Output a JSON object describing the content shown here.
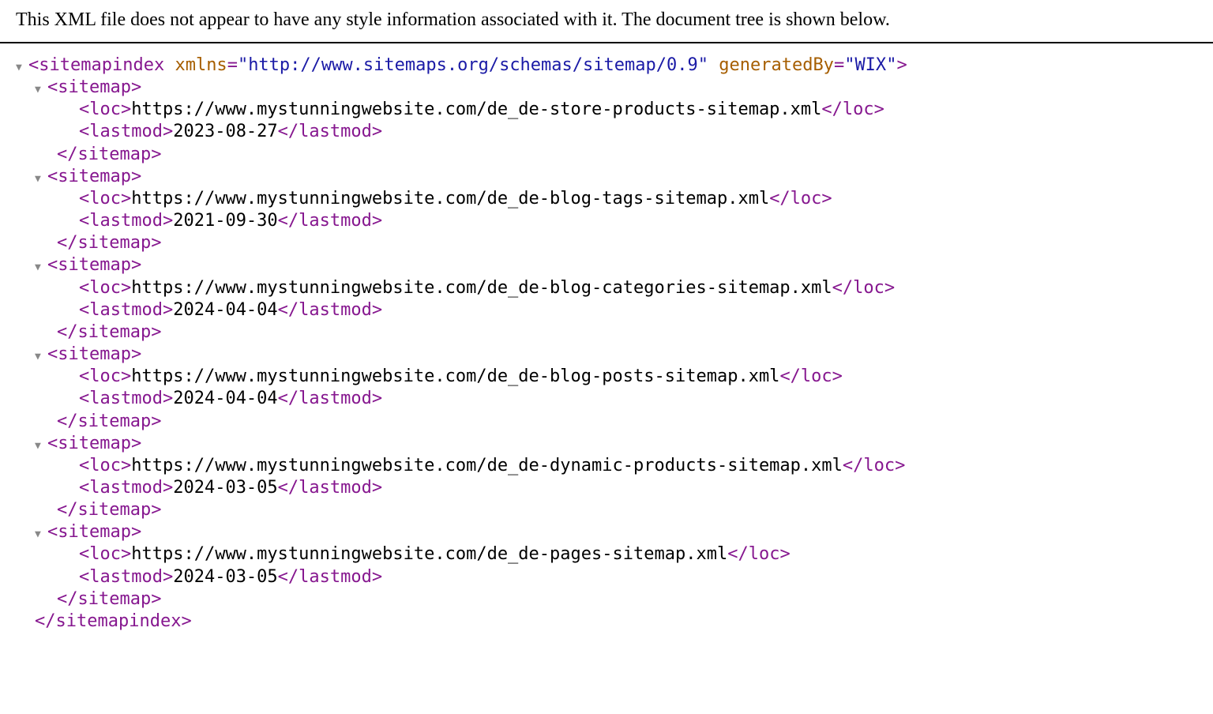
{
  "notice": "This XML file does not appear to have any style information associated with it. The document tree is shown below.",
  "root": {
    "name": "sitemapindex",
    "attrs": [
      {
        "k": "xmlns",
        "v": "http://www.sitemaps.org/schemas/sitemap/0.9"
      },
      {
        "k": "generatedBy",
        "v": "WIX"
      }
    ]
  },
  "sitemap_tag": "sitemap",
  "loc_tag": "loc",
  "lastmod_tag": "lastmod",
  "sitemaps": [
    {
      "loc": "https://www.mystunningwebsite.com/de_de-store-products-sitemap.xml",
      "lastmod": "2023-08-27"
    },
    {
      "loc": "https://www.mystunningwebsite.com/de_de-blog-tags-sitemap.xml",
      "lastmod": "2021-09-30"
    },
    {
      "loc": "https://www.mystunningwebsite.com/de_de-blog-categories-sitemap.xml",
      "lastmod": "2024-04-04"
    },
    {
      "loc": "https://www.mystunningwebsite.com/de_de-blog-posts-sitemap.xml",
      "lastmod": "2024-04-04"
    },
    {
      "loc": "https://www.mystunningwebsite.com/de_de-dynamic-products-sitemap.xml",
      "lastmod": "2024-03-05"
    },
    {
      "loc": "https://www.mystunningwebsite.com/de_de-pages-sitemap.xml",
      "lastmod": "2024-03-05"
    }
  ]
}
